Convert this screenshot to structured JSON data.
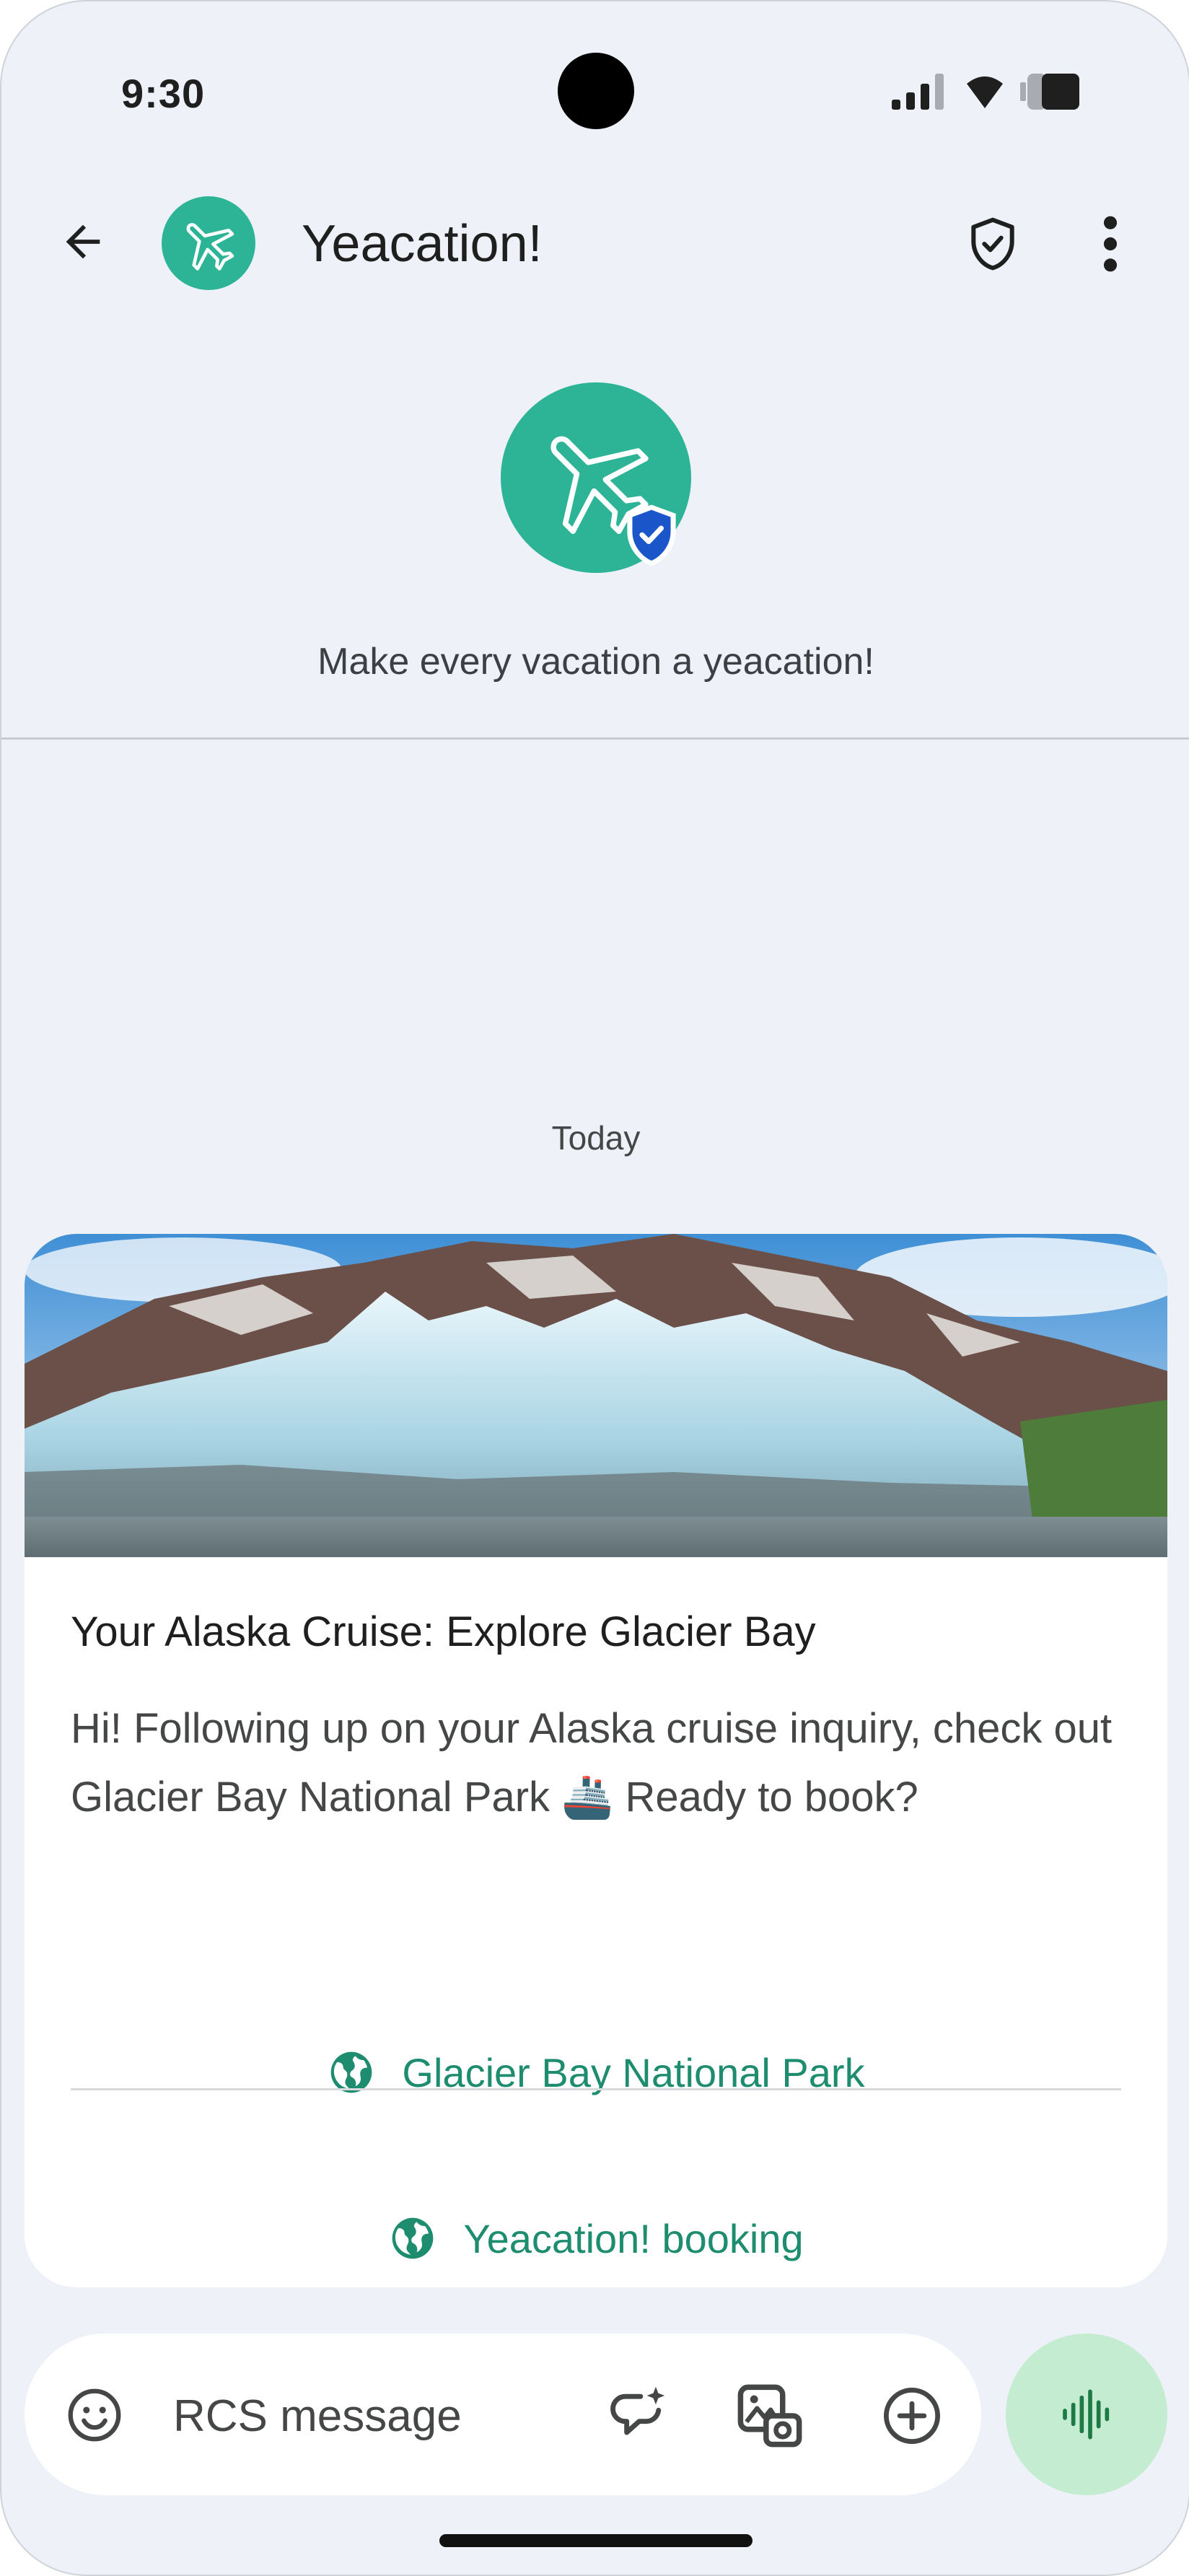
{
  "status_bar": {
    "time": "9:30"
  },
  "header": {
    "title": "Yeacation!",
    "tagline": "Make every vacation a yeacation!"
  },
  "icons": {
    "back": "arrow-left-icon",
    "avatar": "airplane-icon",
    "verified": "verified-shield-icon",
    "security": "shield-check-icon",
    "more": "more-vert-icon",
    "emoji": "emoji-icon",
    "ai_compose": "sparkle-chat-icon",
    "gallery": "gallery-icon",
    "add": "add-circle-icon",
    "voice": "voice-wave-icon",
    "link": "globe-icon"
  },
  "conversation": {
    "date_separator": "Today",
    "card": {
      "title": "Your Alaska Cruise: Explore Glacier Bay",
      "description": "Hi! Following up on your Alaska cruise inquiry, check out Glacier Bay National Park 🚢 Ready to book?",
      "actions": [
        {
          "label": "Glacier Bay National Park"
        },
        {
          "label": "Yeacation! booking"
        }
      ]
    }
  },
  "composer": {
    "placeholder": "RCS message"
  },
  "colors": {
    "brand": "#2db496",
    "link": "#1e8c6e",
    "background": "#eef2f8",
    "voice_button": "#c4ecd1",
    "verified_badge": "#1a56c9"
  }
}
